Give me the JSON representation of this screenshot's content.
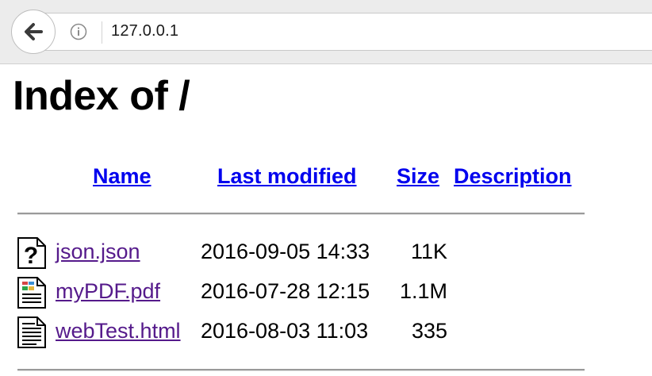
{
  "browser": {
    "url": "127.0.0.1"
  },
  "page": {
    "title": "Index of /",
    "columns": {
      "name": "Name",
      "last_modified": "Last modified",
      "size": "Size",
      "description": "Description"
    },
    "files": [
      {
        "name": "json.json",
        "modified": "2016-09-05 14:33",
        "size": "11K",
        "icon": "unknown-file-icon"
      },
      {
        "name": "myPDF.pdf",
        "modified": "2016-07-28 12:15",
        "size": "1.1M",
        "icon": "layout-document-icon"
      },
      {
        "name": "webTest.html",
        "modified": "2016-08-03 11:03",
        "size": "335",
        "icon": "text-document-icon"
      }
    ]
  },
  "colors": {
    "link": "#0000ee",
    "visited_link": "#551a8b"
  }
}
